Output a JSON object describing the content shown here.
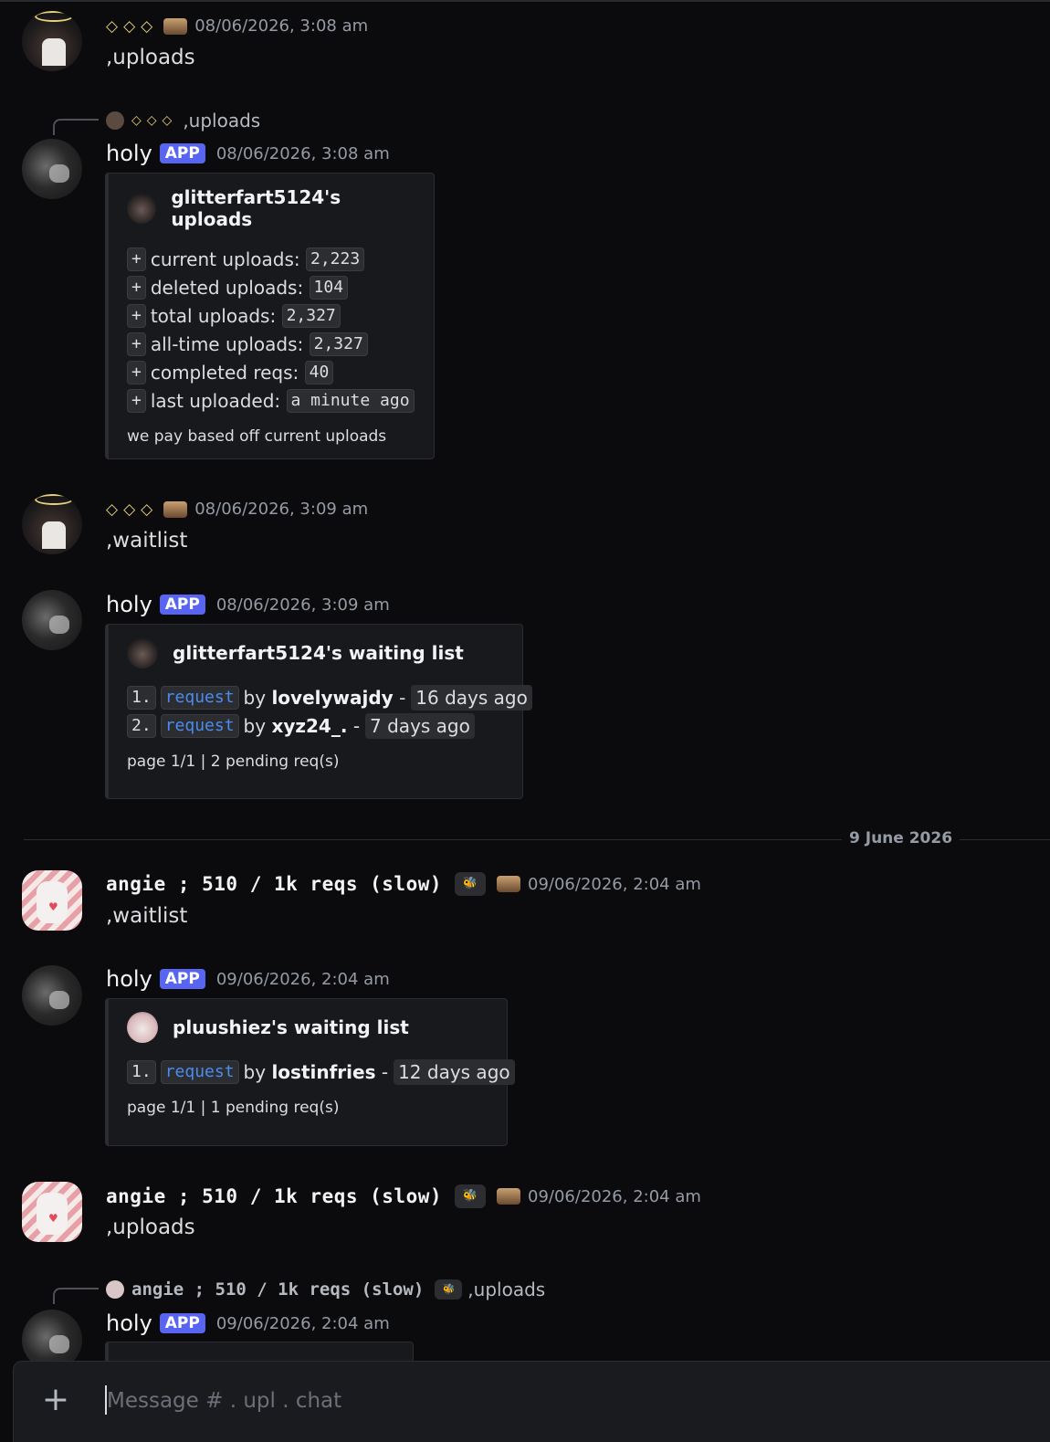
{
  "messages": [
    {
      "author": "◇◇◇",
      "timestamp": "08/06/2026, 3:08 am",
      "text": ",uploads"
    },
    {
      "reply": {
        "author": "◇◇◇",
        "text": ",uploads"
      },
      "author": "holy",
      "badge": "APP",
      "timestamp": "08/06/2026, 3:08 am",
      "embed": {
        "title": "glitterfart5124's uploads",
        "rows": [
          {
            "marker": "+",
            "label": "current uploads:",
            "value": "2,223"
          },
          {
            "marker": "+",
            "label": "deleted uploads:",
            "value": "104"
          },
          {
            "marker": "+",
            "label": "total uploads:",
            "value": "2,327"
          },
          {
            "marker": "+",
            "label": "all-time uploads:",
            "value": "2,327"
          },
          {
            "marker": "+",
            "label": "completed reqs:",
            "value": "40"
          },
          {
            "marker": "+",
            "label": "last uploaded:",
            "value": "a minute ago"
          }
        ],
        "footer": "we pay based off current uploads"
      }
    },
    {
      "author": "◇◇◇",
      "timestamp": "08/06/2026, 3:09 am",
      "text": ",waitlist"
    },
    {
      "author": "holy",
      "badge": "APP",
      "timestamp": "08/06/2026, 3:09 am",
      "embed": {
        "title": "glitterfart5124's waiting list",
        "rows": [
          {
            "num": "1.",
            "link": "request",
            "by": "by",
            "user": "lovelywajdy",
            "sep": "-",
            "ago": "16 days ago"
          },
          {
            "num": "2.",
            "link": "request",
            "by": "by",
            "user": "xyz24_.",
            "sep": "-",
            "ago": "7 days ago"
          }
        ],
        "footer": "page 1/1 | 2 pending req(s)"
      }
    },
    {
      "author": "angie ; 510 / 1k reqs (slow)",
      "timestamp": "09/06/2026, 2:04 am",
      "text": ",waitlist"
    },
    {
      "author": "holy",
      "badge": "APP",
      "timestamp": "09/06/2026, 2:04 am",
      "embed": {
        "title": "pluushiez's waiting list",
        "rows": [
          {
            "num": "1.",
            "link": "request",
            "by": "by",
            "user": "lostinfries",
            "sep": "-",
            "ago": "12 days ago"
          }
        ],
        "footer": "page 1/1 | 1 pending req(s)"
      }
    },
    {
      "author": "angie ; 510 / 1k reqs (slow)",
      "timestamp": "09/06/2026, 2:04 am",
      "text": ",uploads"
    },
    {
      "reply": {
        "author": "angie ; 510 / 1k reqs (slow)",
        "text": ",uploads"
      },
      "author": "holy",
      "badge": "APP",
      "timestamp": "09/06/2026, 2:04 am"
    }
  ],
  "date_divider": "9 June 2026",
  "composer": {
    "placeholder": "Message # . upl . chat"
  },
  "icons": {
    "add": "plus-icon",
    "badge": "bee-badge-icon"
  },
  "colors": {
    "app_badge": "#5865f2",
    "link": "#4a8cf0",
    "background": "#0b0b0d"
  }
}
